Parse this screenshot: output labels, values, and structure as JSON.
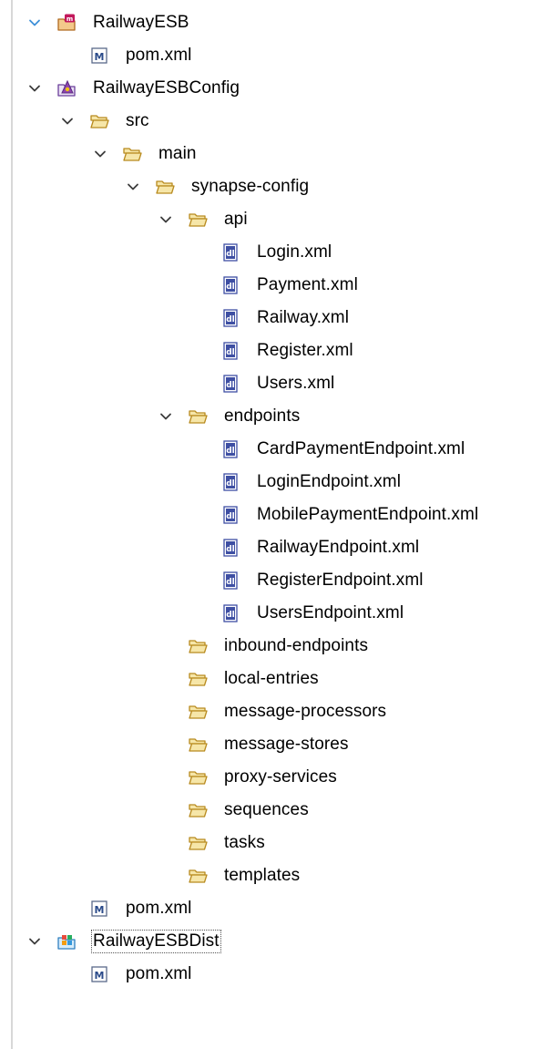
{
  "tree": {
    "rows": [
      {
        "label": "RailwayESB",
        "depth": 0,
        "icon": "maven-project-icon",
        "expanded": true,
        "chevron_color": "#3d8fd8"
      },
      {
        "label": "pom.xml",
        "depth": 1,
        "icon": "maven-pom-icon"
      },
      {
        "label": "RailwayESBConfig",
        "depth": 0,
        "icon": "esb-config-project-icon",
        "expanded": true
      },
      {
        "label": "src",
        "depth": 1,
        "icon": "folder-icon",
        "expanded": true
      },
      {
        "label": "main",
        "depth": 2,
        "icon": "folder-icon",
        "expanded": true
      },
      {
        "label": "synapse-config",
        "depth": 3,
        "icon": "folder-icon",
        "expanded": true
      },
      {
        "label": "api",
        "depth": 4,
        "icon": "folder-icon",
        "expanded": true
      },
      {
        "label": "Login.xml",
        "depth": 5,
        "icon": "xml-file-icon"
      },
      {
        "label": "Payment.xml",
        "depth": 5,
        "icon": "xml-file-icon"
      },
      {
        "label": "Railway.xml",
        "depth": 5,
        "icon": "xml-file-icon"
      },
      {
        "label": "Register.xml",
        "depth": 5,
        "icon": "xml-file-icon"
      },
      {
        "label": "Users.xml",
        "depth": 5,
        "icon": "xml-file-icon"
      },
      {
        "label": "endpoints",
        "depth": 4,
        "icon": "folder-icon",
        "expanded": true
      },
      {
        "label": "CardPaymentEndpoint.xml",
        "depth": 5,
        "icon": "xml-file-icon"
      },
      {
        "label": "LoginEndpoint.xml",
        "depth": 5,
        "icon": "xml-file-icon"
      },
      {
        "label": "MobilePaymentEndpoint.xml",
        "depth": 5,
        "icon": "xml-file-icon"
      },
      {
        "label": "RailwayEndpoint.xml",
        "depth": 5,
        "icon": "xml-file-icon"
      },
      {
        "label": "RegisterEndpoint.xml",
        "depth": 5,
        "icon": "xml-file-icon"
      },
      {
        "label": "UsersEndpoint.xml",
        "depth": 5,
        "icon": "xml-file-icon"
      },
      {
        "label": "inbound-endpoints",
        "depth": 4,
        "icon": "folder-icon"
      },
      {
        "label": "local-entries",
        "depth": 4,
        "icon": "folder-icon"
      },
      {
        "label": "message-processors",
        "depth": 4,
        "icon": "folder-icon"
      },
      {
        "label": "message-stores",
        "depth": 4,
        "icon": "folder-icon"
      },
      {
        "label": "proxy-services",
        "depth": 4,
        "icon": "folder-icon"
      },
      {
        "label": "sequences",
        "depth": 4,
        "icon": "folder-icon"
      },
      {
        "label": "tasks",
        "depth": 4,
        "icon": "folder-icon"
      },
      {
        "label": "templates",
        "depth": 4,
        "icon": "folder-icon"
      },
      {
        "label": "pom.xml",
        "depth": 1,
        "icon": "maven-pom-icon"
      },
      {
        "label": "RailwayESBDist",
        "depth": 0,
        "icon": "composite-app-project-icon",
        "expanded": true,
        "focused": true
      },
      {
        "label": "pom.xml",
        "depth": 1,
        "icon": "maven-pom-icon"
      }
    ]
  },
  "colors": {
    "chevron": "#3c3c3c",
    "folder_fill": "#f6e6a8",
    "folder_stroke": "#b88a1e",
    "xml_blue": "#3e4fa3"
  }
}
